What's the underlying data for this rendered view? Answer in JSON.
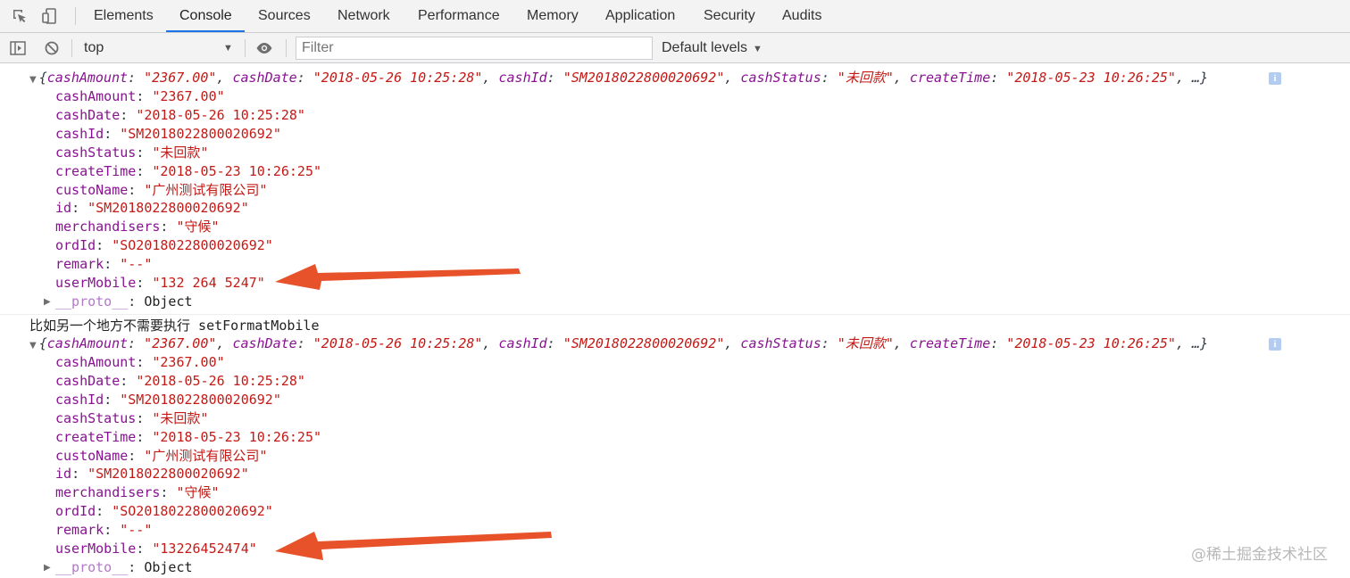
{
  "tabbar": {
    "tabs": [
      "Elements",
      "Console",
      "Sources",
      "Network",
      "Performance",
      "Memory",
      "Application",
      "Security",
      "Audits"
    ],
    "active_tab": "Console"
  },
  "toolbar": {
    "context_value": "top",
    "filter_placeholder": "Filter",
    "filter_value": "",
    "levels_label": "Default levels"
  },
  "console": {
    "object1": {
      "summary": {
        "open": "{",
        "items": [
          {
            "k": "cashAmount",
            "v": "\"2367.00\""
          },
          {
            "k": "cashDate",
            "v": "\"2018-05-26 10:25:28\""
          },
          {
            "k": "cashId",
            "v": "\"SM2018022800020692\""
          },
          {
            "k": "cashStatus",
            "v": "\"未回款\""
          },
          {
            "k": "createTime",
            "v": "\"2018-05-23 10:26:25\""
          }
        ],
        "ellipsis": "…}"
      },
      "props": [
        {
          "k": "cashAmount",
          "v": "\"2367.00\""
        },
        {
          "k": "cashDate",
          "v": "\"2018-05-26 10:25:28\""
        },
        {
          "k": "cashId",
          "v": "\"SM2018022800020692\""
        },
        {
          "k": "cashStatus",
          "v": "\"未回款\""
        },
        {
          "k": "createTime",
          "v": "\"2018-05-23 10:26:25\""
        },
        {
          "k": "custoName",
          "v": "\"广州测试有限公司\""
        },
        {
          "k": "id",
          "v": "\"SM2018022800020692\""
        },
        {
          "k": "merchandisers",
          "v": "\"守候\""
        },
        {
          "k": "ordId",
          "v": "\"SO2018022800020692\""
        },
        {
          "k": "remark",
          "v": "\"--\""
        },
        {
          "k": "userMobile",
          "v": "\"132 264 5247\""
        }
      ],
      "proto_key": "__proto__",
      "proto_val": "Object"
    },
    "log_message": "比如另一个地方不需要执行 setFormatMobile",
    "object2": {
      "summary": {
        "open": "{",
        "items": [
          {
            "k": "cashAmount",
            "v": "\"2367.00\""
          },
          {
            "k": "cashDate",
            "v": "\"2018-05-26 10:25:28\""
          },
          {
            "k": "cashId",
            "v": "\"SM2018022800020692\""
          },
          {
            "k": "cashStatus",
            "v": "\"未回款\""
          },
          {
            "k": "createTime",
            "v": "\"2018-05-23 10:26:25\""
          }
        ],
        "ellipsis": "…}"
      },
      "props": [
        {
          "k": "cashAmount",
          "v": "\"2367.00\""
        },
        {
          "k": "cashDate",
          "v": "\"2018-05-26 10:25:28\""
        },
        {
          "k": "cashId",
          "v": "\"SM2018022800020692\""
        },
        {
          "k": "cashStatus",
          "v": "\"未回款\""
        },
        {
          "k": "createTime",
          "v": "\"2018-05-23 10:26:25\""
        },
        {
          "k": "custoName",
          "v": "\"广州测试有限公司\""
        },
        {
          "k": "id",
          "v": "\"SM2018022800020692\""
        },
        {
          "k": "merchandisers",
          "v": "\"守候\""
        },
        {
          "k": "ordId",
          "v": "\"SO2018022800020692\""
        },
        {
          "k": "remark",
          "v": "\"--\""
        },
        {
          "k": "userMobile",
          "v": "\"13226452474\""
        }
      ],
      "proto_key": "__proto__",
      "proto_val": "Object"
    },
    "info_badge": "i"
  },
  "annotation_color": "#e8522a",
  "watermark": "@稀土掘金技术社区"
}
